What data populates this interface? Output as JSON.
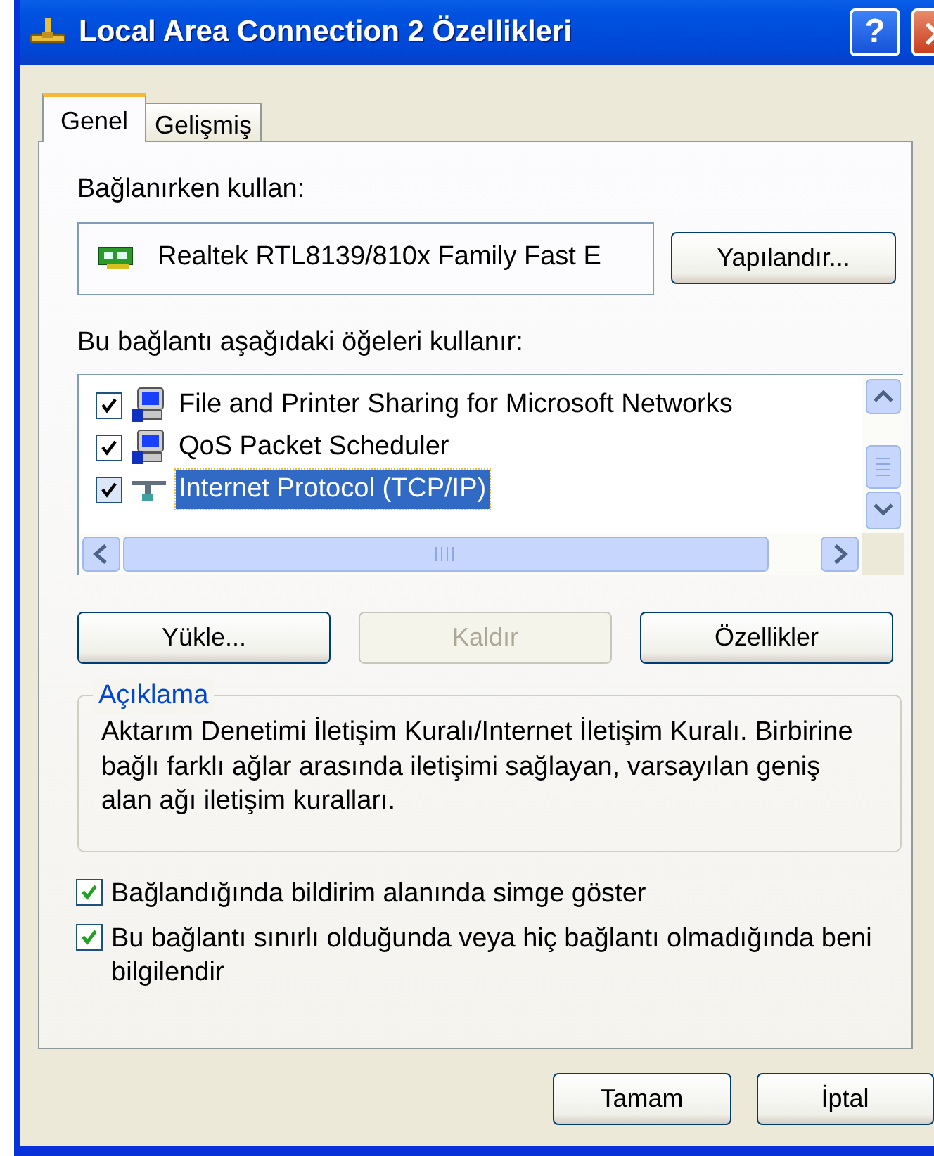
{
  "window": {
    "title": "Local Area Connection 2 Özellikleri",
    "help_button": "?"
  },
  "tabs": [
    {
      "label": "Genel",
      "selected": true
    },
    {
      "label": "Gelişmiş",
      "selected": false
    }
  ],
  "connect_using": {
    "label": "Bağlanırken kullan:",
    "adapter": "Realtek RTL8139/810x Family Fast E",
    "button": "Yapılandır..."
  },
  "components": {
    "label": "Bu bağlantı aşağıdaki öğeleri kullanır:",
    "items": [
      {
        "name": "File and Printer Sharing for Microsoft Networks",
        "checked": true,
        "selected": false,
        "kind": "service"
      },
      {
        "name": "QoS Packet Scheduler",
        "checked": true,
        "selected": false,
        "kind": "service"
      },
      {
        "name": "Internet Protocol (TCP/IP)",
        "checked": true,
        "selected": true,
        "kind": "protocol"
      }
    ]
  },
  "component_buttons": [
    {
      "label": "Yükle...",
      "disabled": false
    },
    {
      "label": "Kaldır",
      "disabled": true
    },
    {
      "label": "Özellikler",
      "disabled": false
    }
  ],
  "description": {
    "title": "Açıklama",
    "text": "Aktarım Denetimi İletişim Kuralı/Internet İletişim Kuralı. Birbirine bağlı farklı ağlar arasında iletişimi sağlayan, varsayılan geniş alan ağı iletişim kuralları."
  },
  "options": [
    {
      "label": "Bağlandığında bildirim alanında simge göster",
      "checked": true
    },
    {
      "label": "Bu bağlantı sınırlı olduğunda veya hiç bağlantı olmadığında beni bilgilendir",
      "checked": true
    }
  ],
  "buttons": [
    "Tamam",
    "İptal"
  ]
}
